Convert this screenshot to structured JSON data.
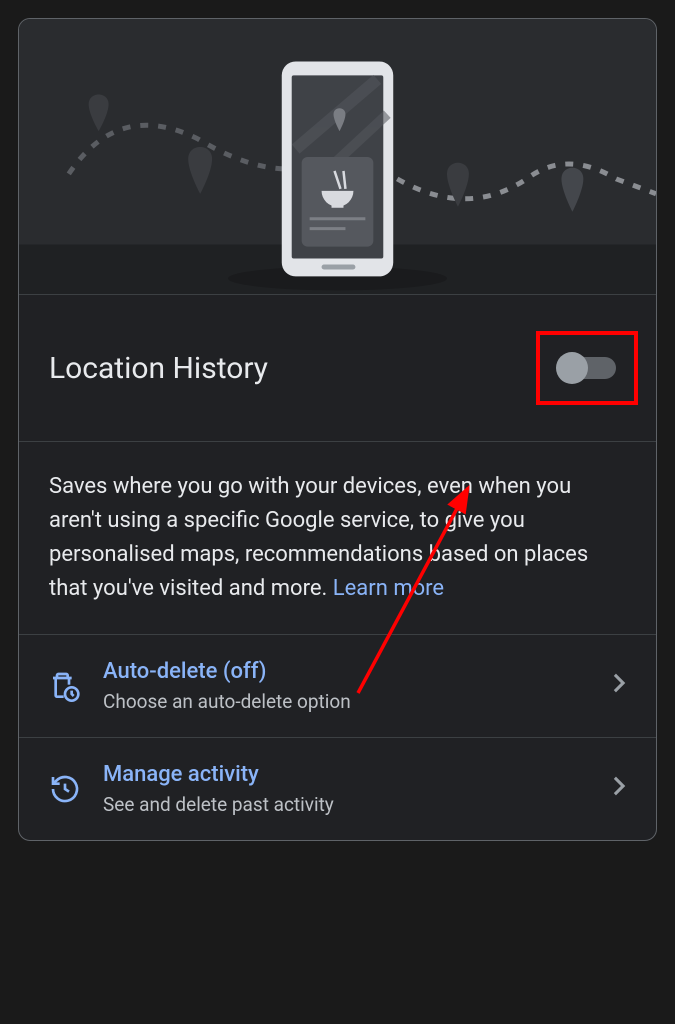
{
  "title": "Location History",
  "description": "Saves where you go with your devices, even when you aren't using a specific Google service, to give you personalised maps, recommendations based on places that you've visited and more. ",
  "learn_more_label": "Learn more",
  "options": {
    "auto_delete": {
      "title": "Auto-delete (off)",
      "subtitle": "Choose an auto-delete option"
    },
    "manage_activity": {
      "title": "Manage activity",
      "subtitle": "See and delete past activity"
    }
  }
}
